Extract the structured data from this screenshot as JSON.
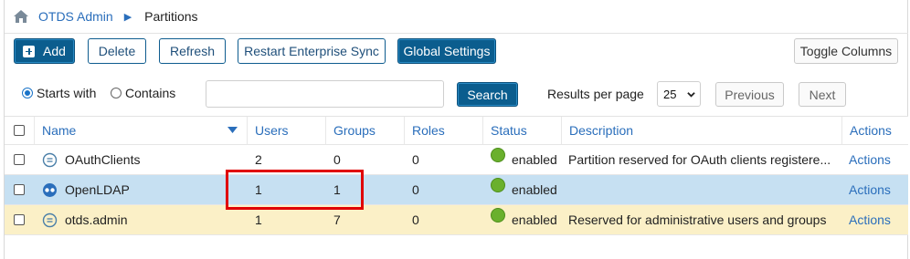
{
  "breadcrumb": {
    "root": "OTDS Admin",
    "separator": "▶",
    "current": "Partitions"
  },
  "toolbar": {
    "add": "Add",
    "delete": "Delete",
    "refresh": "Refresh",
    "restart_sync": "Restart Enterprise Sync",
    "global_settings": "Global Settings",
    "toggle_columns": "Toggle Columns"
  },
  "search": {
    "starts_with": "Starts with",
    "contains": "Contains",
    "value": "",
    "button": "Search",
    "results_per_page_label": "Results per page",
    "results_per_page_value": "25",
    "previous": "Previous",
    "next": "Next"
  },
  "table": {
    "headers": {
      "name": "Name",
      "users": "Users",
      "groups": "Groups",
      "roles": "Roles",
      "status": "Status",
      "description": "Description",
      "actions": "Actions"
    },
    "rows": [
      {
        "name": "OAuthClients",
        "icon": "partition-icon",
        "users": "2",
        "groups": "0",
        "roles": "0",
        "status": "enabled",
        "description": "Partition reserved for OAuth clients registere...",
        "actions": "Actions"
      },
      {
        "name": "OpenLDAP",
        "icon": "synced-partition-icon",
        "users": "1",
        "groups": "1",
        "roles": "0",
        "status": "enabled",
        "description": "",
        "actions": "Actions"
      },
      {
        "name": "otds.admin",
        "icon": "partition-icon",
        "users": "1",
        "groups": "7",
        "roles": "0",
        "status": "enabled",
        "description": "Reserved for administrative users and groups",
        "actions": "Actions"
      }
    ]
  },
  "colors": {
    "accent": "#0b5d8e",
    "link": "#2a6ebb",
    "selected_row": "#c6e0f2",
    "admin_row": "#fbf0c7",
    "status_enabled": "#6ab02d",
    "highlight": "#e00000"
  }
}
